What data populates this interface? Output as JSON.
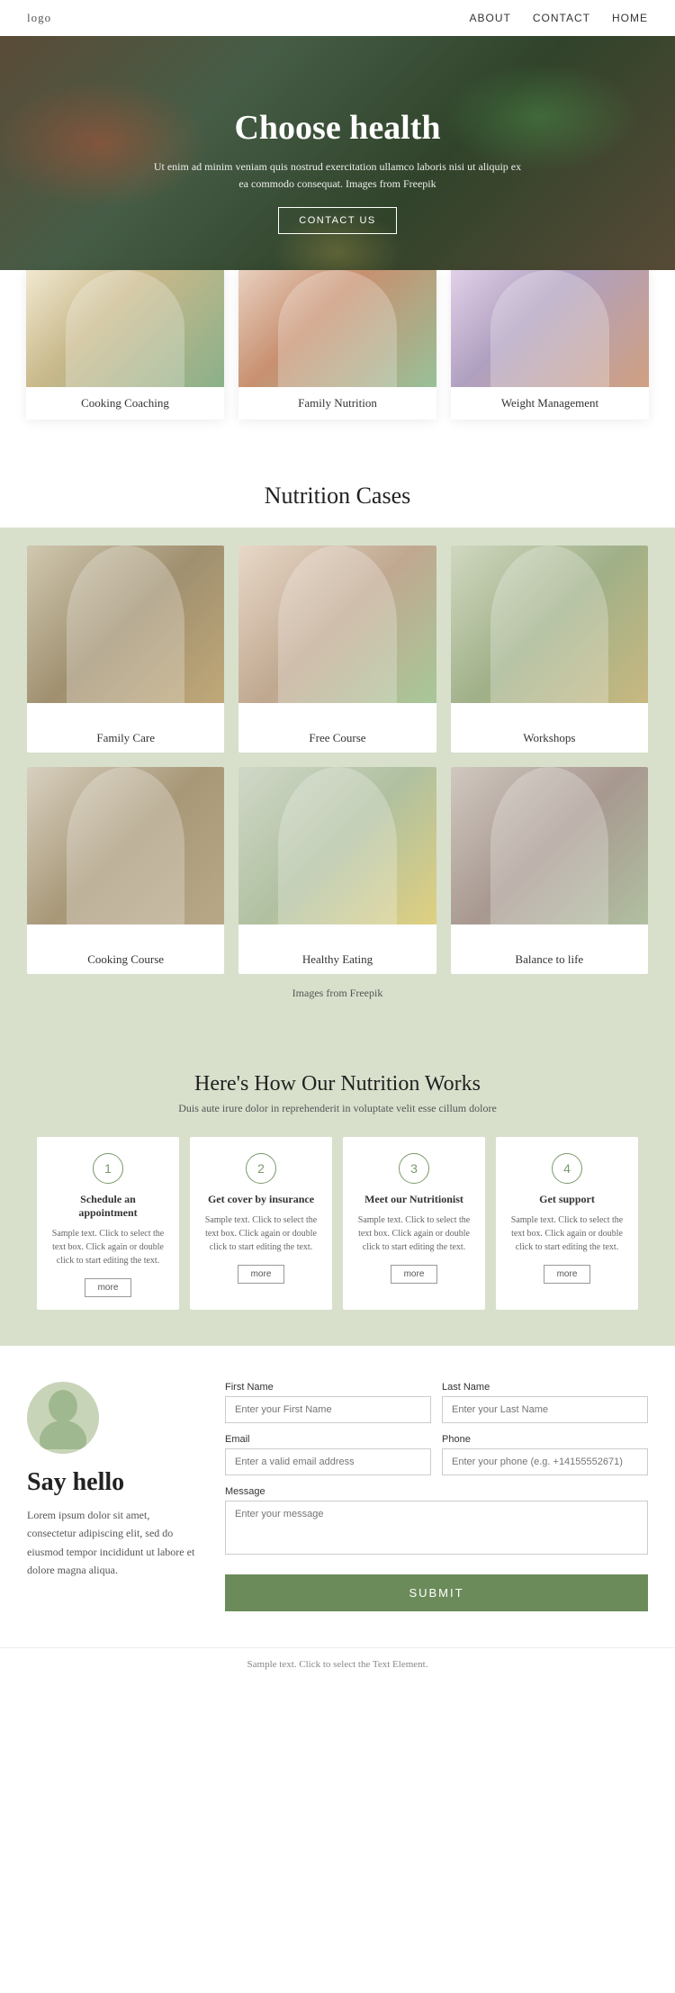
{
  "nav": {
    "logo": "logo",
    "links": [
      {
        "label": "ABOUT",
        "href": "#"
      },
      {
        "label": "CONTACT",
        "href": "#"
      },
      {
        "label": "HOME",
        "href": "#"
      }
    ]
  },
  "hero": {
    "title": "Choose health",
    "description": "Ut enim ad minim veniam quis nostrud exercitation ullamco laboris nisi ut aliquip ex ea commodo consequat. Images from Freepik",
    "button_label": "CONTACT US"
  },
  "service_cards": [
    {
      "label": "Cooking Coaching",
      "img_class": "img-cooking-coaching"
    },
    {
      "label": "Family Nutrition",
      "img_class": "img-family-nutrition"
    },
    {
      "label": "Weight Management",
      "img_class": "img-weight-management"
    }
  ],
  "nutrition_cases": {
    "title": "Nutrition Cases",
    "items": [
      {
        "label": "Family Care",
        "img_class": "img-family-care"
      },
      {
        "label": "Free Course",
        "img_class": "img-free-course"
      },
      {
        "label": "Workshops",
        "img_class": "img-workshops"
      },
      {
        "label": "Cooking Course",
        "img_class": "img-cooking-course"
      },
      {
        "label": "Healthy Eating",
        "img_class": "img-healthy-eating"
      },
      {
        "label": "Balance to life",
        "img_class": "img-balance-life"
      }
    ],
    "freepik_text": "Images from ",
    "freepik_link": "Freepik"
  },
  "how_section": {
    "title": "Here's How Our Nutrition Works",
    "subtitle": "Duis aute irure dolor in reprehenderit in voluptate velit esse cillum dolore",
    "steps": [
      {
        "number": "1",
        "heading": "Schedule an appointment",
        "text": "Sample text. Click to select the text box. Click again or double click to start editing the text.",
        "more": "more"
      },
      {
        "number": "2",
        "heading": "Get cover by insurance",
        "text": "Sample text. Click to select the text box. Click again or double click to start editing the text.",
        "more": "more"
      },
      {
        "number": "3",
        "heading": "Meet our Nutritionist",
        "text": "Sample text. Click to select the text box. Click again or double click to start editing the text.",
        "more": "more"
      },
      {
        "number": "4",
        "heading": "Get support",
        "text": "Sample text. Click to select the text box. Click again or double click to start editing the text.",
        "more": "more"
      }
    ]
  },
  "contact": {
    "greeting": "Say hello",
    "body_text": "Lorem ipsum dolor sit amet, consectetur adipiscing elit, sed do eiusmod tempor incididunt ut labore et dolore magna aliqua.",
    "form": {
      "first_name_label": "First Name",
      "first_name_placeholder": "Enter your First Name",
      "last_name_label": "Last Name",
      "last_name_placeholder": "Enter your Last Name",
      "email_label": "Email",
      "email_placeholder": "Enter a valid email address",
      "phone_label": "Phone",
      "phone_placeholder": "Enter your phone (e.g. +14155552671)",
      "message_label": "Message",
      "message_placeholder": "Enter your message",
      "submit_label": "SUBMIT"
    }
  },
  "footer": {
    "note": "Sample text. Click to select the Text Element."
  }
}
